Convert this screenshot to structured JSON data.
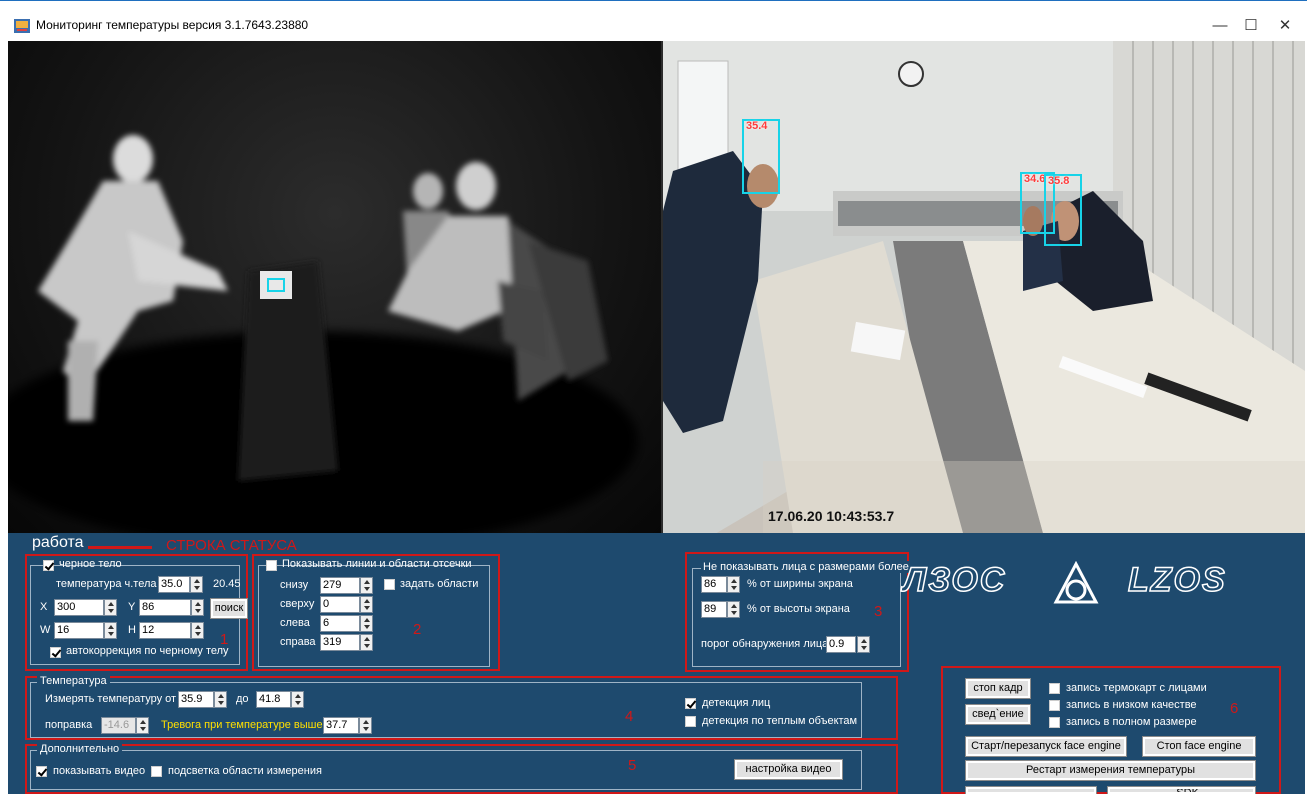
{
  "window": {
    "title": "Мониторинг температуры  версия 3.1.7643.23880",
    "minimize": "—",
    "maximize": "☐",
    "close": "✕"
  },
  "video": {
    "timestamp": "17.06.20 10:43:53.7",
    "faces": [
      {
        "temp": "35.4"
      },
      {
        "temp": "34.6"
      },
      {
        "temp": "35.8"
      }
    ]
  },
  "status": {
    "text": "работа",
    "annotation": "СТРОКА СТАТУСА"
  },
  "blackbody": {
    "checkbox_label": "черное тело",
    "checked": true,
    "temp_label": "температура ч.тела",
    "temp_value": "35.0",
    "temp_measured": "20.45",
    "x_label": "X",
    "x": "300",
    "y_label": "Y",
    "y": "86",
    "w_label": "W",
    "w": "16",
    "h_label": "H",
    "h": "12",
    "search_button": "поиск",
    "autocorrect_label": "автокоррекция по черному телу",
    "autocorrect_checked": true,
    "marker": "1"
  },
  "cutoff": {
    "checkbox_label": "Показывать линии и области отсечки",
    "checked": false,
    "bottom_label": "снизу",
    "bottom": "279",
    "top_label": "сверху",
    "top": "0",
    "left_label": "слева",
    "left": "6",
    "right_label": "справа",
    "right": "319",
    "set_areas_label": "задать области",
    "marker": "2"
  },
  "faces_filter": {
    "title": "Не показывать лица с размерами более",
    "width_value": "86",
    "width_label": "% от ширины экрана",
    "height_value": "89",
    "height_label": "% от высоты экрана",
    "threshold_label": "порог обнаружения лица",
    "threshold_value": "0.9",
    "marker": "3"
  },
  "temperature": {
    "title": "Температура",
    "range_label": "Измерять температуру от",
    "from": "35.9",
    "to_label": "до",
    "to": "41.8",
    "correction_label": "поправка",
    "correction": "-14.6",
    "alarm_label": "Тревога при температуре выше",
    "alarm": "37.7",
    "face_detect_label": "детекция лиц",
    "face_detect_checked": true,
    "warm_detect_label": "детекция по теплым объектам",
    "warm_detect_checked": false,
    "marker": "4"
  },
  "extra": {
    "title": "Дополнительно",
    "show_video_label": "показывать видео",
    "show_video_checked": true,
    "highlight_label": "подсветка области измерения",
    "highlight_checked": false,
    "video_settings_button": "настройка видео",
    "marker": "5"
  },
  "logo": {
    "left": "ЛЗОС",
    "right": "LZOS"
  },
  "actions": {
    "stop_frame": "стоп кадр",
    "fusion": "свед`ение",
    "record_faces_label": "запись термокарт с лицами",
    "record_low_label": "запись в низком качестве",
    "record_full_label": "запись в полном размере",
    "start_engine": "Старт/перезапуск face engine",
    "stop_engine": "Стоп face engine",
    "restart_measure": "Рестарт измерения температуры",
    "cut_sdk": "... SDK",
    "marker": "6"
  },
  "colors": {
    "panel": "#1e4a6e",
    "annotation": "#d01818",
    "alarm_text": "#ffe000",
    "bbox": "#17d3e8"
  }
}
